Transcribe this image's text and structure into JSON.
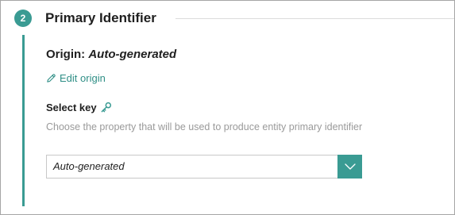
{
  "section": {
    "step_number": "2",
    "title": "Primary Identifier"
  },
  "origin": {
    "label": "Origin:",
    "value": "Auto-generated",
    "edit_label": "Edit origin"
  },
  "key_select": {
    "label": "Select key",
    "help_text": "Choose the property that will be used to produce entity primary identifier",
    "selected_value": "Auto-generated"
  },
  "colors": {
    "accent": "#3a9b93",
    "link": "#2f8f86",
    "muted_text": "#9a9a9a"
  },
  "icons": {
    "edit": "pencil-icon",
    "key": "key-icon",
    "dropdown": "chevron-down-icon"
  }
}
